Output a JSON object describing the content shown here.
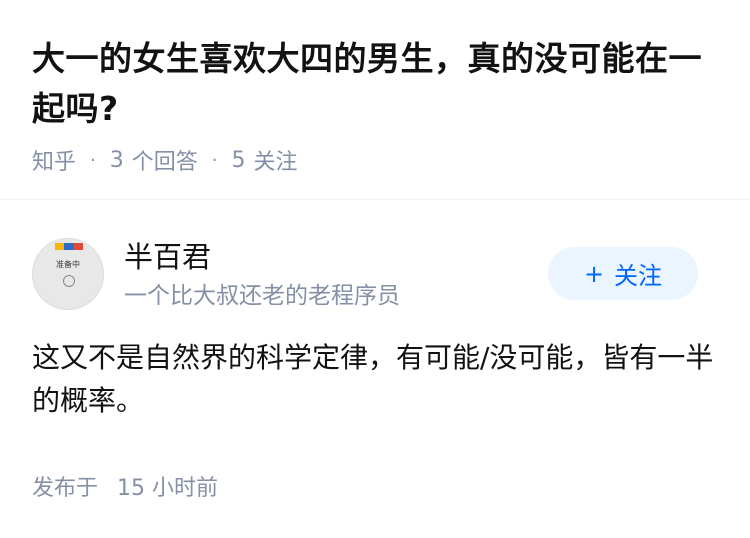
{
  "question": {
    "title": "大一的女生喜欢大四的男生，真的没可能在一起吗?",
    "source": "知乎",
    "answers_count": "3",
    "answers_label": "个回答",
    "follow_count": "5",
    "follow_label": "关注"
  },
  "answer": {
    "author_name": "半百君",
    "author_bio": "一个比大叔还老的老程序员",
    "follow_button_label": "关注",
    "follow_button_icon": "plus-icon",
    "avatar_text": "准备中",
    "content": "这又不是自然界的科学定律，有可能/没可能，皆有一半的概率。",
    "time_prefix": "发布于",
    "time_value": "15 小时前"
  },
  "colors": {
    "text": "#121212",
    "meta": "#8590a6",
    "accent": "#0066ff",
    "button_bg": "#ebf5ff"
  }
}
